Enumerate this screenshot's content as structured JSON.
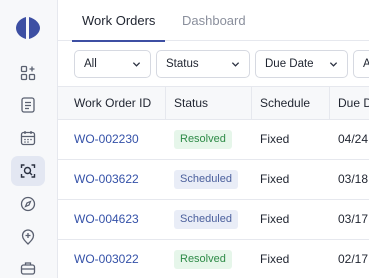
{
  "tabs": [
    {
      "label": "Work Orders",
      "active": true
    },
    {
      "label": "Dashboard",
      "active": false
    }
  ],
  "filters": [
    {
      "value": "All"
    },
    {
      "value": "Status"
    },
    {
      "value": "Due Date"
    },
    {
      "value": "A"
    }
  ],
  "table": {
    "columns": [
      "Work Order ID",
      "Status",
      "Schedule",
      "Due D"
    ],
    "rows": [
      {
        "id": "WO-002230",
        "status": "Resolved",
        "schedule": "Fixed",
        "due": "04/24"
      },
      {
        "id": "WO-003622",
        "status": "Scheduled",
        "schedule": "Fixed",
        "due": "03/18"
      },
      {
        "id": "WO-004623",
        "status": "Scheduled",
        "schedule": "Fixed",
        "due": "03/17,"
      },
      {
        "id": "WO-003022",
        "status": "Resolved",
        "schedule": "Fixed",
        "due": "02/17,"
      }
    ]
  },
  "sidebar": {
    "items": [
      {
        "icon": "apps-grid-icon",
        "active": false
      },
      {
        "icon": "document-icon",
        "active": false
      },
      {
        "icon": "calendar-icon",
        "active": false
      },
      {
        "icon": "work-orders-icon",
        "active": true
      },
      {
        "icon": "compass-icon",
        "active": false
      },
      {
        "icon": "location-pin-icon",
        "active": false
      },
      {
        "icon": "toolbox-icon",
        "active": false
      }
    ]
  },
  "colors": {
    "accent": "#3d4fa3",
    "link": "#3451a8",
    "resolved_bg": "#e6f6ea",
    "resolved_text": "#2e8b47",
    "scheduled_bg": "#e9edf7",
    "scheduled_text": "#4a5f9c"
  }
}
